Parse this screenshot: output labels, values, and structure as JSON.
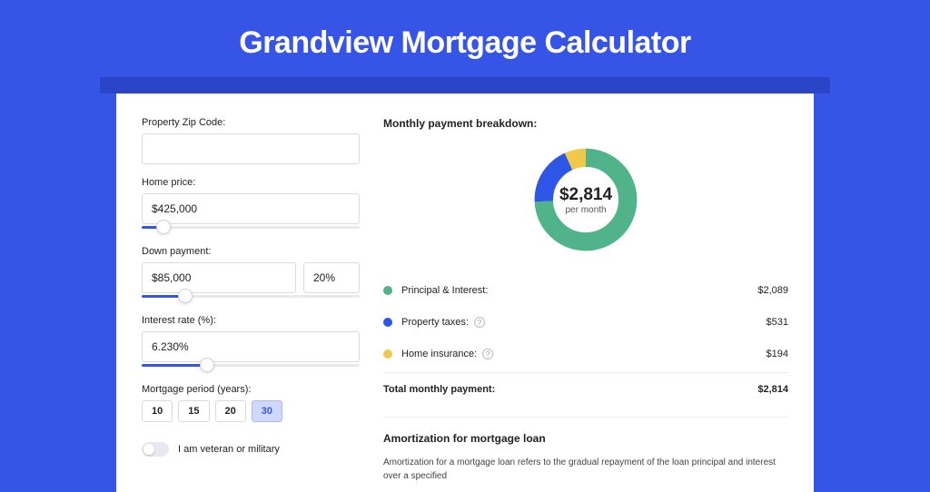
{
  "title": "Grandview Mortgage Calculator",
  "form": {
    "zip_label": "Property Zip Code:",
    "zip_value": "",
    "home_price_label": "Home price:",
    "home_price_value": "$425,000",
    "home_price_slider_pct": 10,
    "down_payment_label": "Down payment:",
    "down_payment_value": "$85,000",
    "down_payment_pct_value": "20%",
    "down_payment_slider_pct": 20,
    "interest_label": "Interest rate (%):",
    "interest_value": "6.230%",
    "interest_slider_pct": 30,
    "period_label": "Mortgage period (years):",
    "periods": [
      {
        "label": "10",
        "active": false
      },
      {
        "label": "15",
        "active": false
      },
      {
        "label": "20",
        "active": false
      },
      {
        "label": "30",
        "active": true
      }
    ],
    "veteran_label": "I am veteran or military"
  },
  "breakdown": {
    "title": "Monthly payment breakdown:",
    "total_amount": "$2,814",
    "per_month": "per month",
    "items": [
      {
        "label": "Principal & Interest:",
        "value": "$2,089",
        "color": "#51b38a",
        "help": false
      },
      {
        "label": "Property taxes:",
        "value": "$531",
        "color": "#2d55e6",
        "help": true
      },
      {
        "label": "Home insurance:",
        "value": "$194",
        "color": "#f0c94a",
        "help": true
      }
    ],
    "total_label": "Total monthly payment:",
    "total_value": "$2,814"
  },
  "amortization": {
    "title": "Amortization for mortgage loan",
    "text": "Amortization for a mortgage loan refers to the gradual repayment of the loan principal and interest over a specified"
  },
  "chart_data": {
    "type": "pie",
    "title": "Monthly payment breakdown",
    "series": [
      {
        "name": "Principal & Interest",
        "value": 2089,
        "color": "#51b38a"
      },
      {
        "name": "Property taxes",
        "value": 531,
        "color": "#2d55e6"
      },
      {
        "name": "Home insurance",
        "value": 194,
        "color": "#f0c94a"
      }
    ],
    "total": 2814,
    "center_label": "$2,814 per month"
  }
}
